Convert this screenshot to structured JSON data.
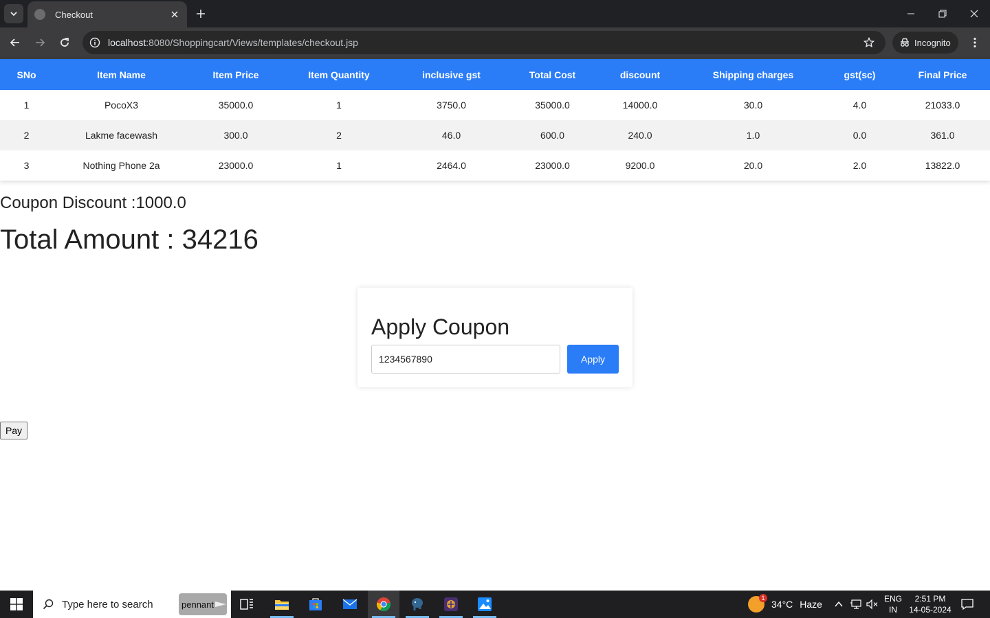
{
  "browser": {
    "tab_title": "Checkout",
    "url_host": "localhost",
    "url_rest": ":8080/Shoppingcart/Views/templates/checkout.jsp",
    "incognito_label": "Incognito"
  },
  "cart": {
    "headers": [
      "SNo",
      "Item Name",
      "Item Price",
      "Item Quantity",
      "inclusive gst",
      "Total Cost",
      "discount",
      "Shipping charges",
      "gst(sc)",
      "Final Price"
    ],
    "rows": [
      [
        "1",
        "PocoX3",
        "35000.0",
        "1",
        "3750.0",
        "35000.0",
        "14000.0",
        "30.0",
        "4.0",
        "21033.0"
      ],
      [
        "2",
        "Lakme facewash",
        "300.0",
        "2",
        "46.0",
        "600.0",
        "240.0",
        "1.0",
        "0.0",
        "361.0"
      ],
      [
        "3",
        "Nothing Phone 2a",
        "23000.0",
        "1",
        "2464.0",
        "23000.0",
        "9200.0",
        "20.0",
        "2.0",
        "13822.0"
      ]
    ]
  },
  "summary": {
    "coupon_discount": "Coupon Discount :1000.0",
    "total_amount": "Total Amount : 34216"
  },
  "coupon": {
    "title": "Apply Coupon",
    "input_value": "1234567890",
    "apply_label": "Apply"
  },
  "pay_label": "Pay",
  "taskbar": {
    "search_placeholder": "Type here to search",
    "search_badge": "pennant",
    "weather_badge": "1",
    "weather_temp": "34°C",
    "weather_desc": "Haze",
    "lang_line1": "ENG",
    "lang_line2": "IN",
    "time": "2:51 PM",
    "date": "14-05-2024"
  },
  "colors": {
    "accent": "#2a7cf7",
    "chrome_dark": "#202124",
    "toolbar": "#3c3c3f",
    "taskbar": "#1f1f22"
  }
}
